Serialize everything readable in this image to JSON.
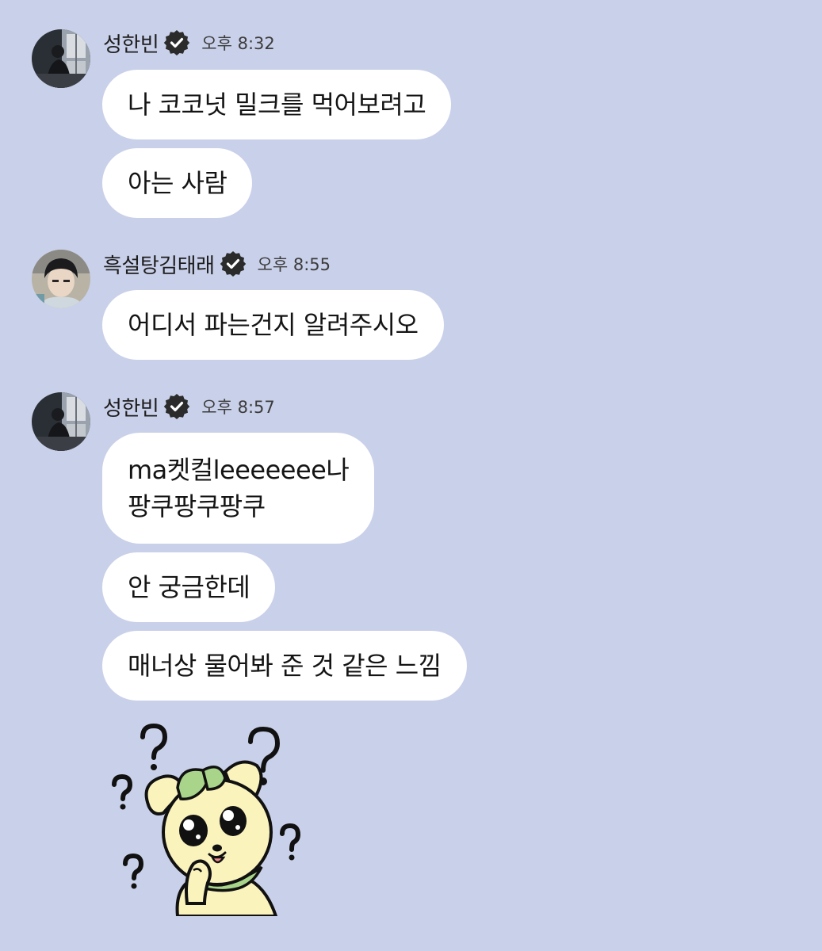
{
  "colors": {
    "background": "#c9d0e9",
    "bubble": "#ffffff",
    "verified_badge": "#2b2b2b",
    "sticker_face": "#fbf3bc",
    "sticker_leaf": "#a8d58a"
  },
  "messages": [
    {
      "sender": "성한빈",
      "verified": true,
      "time": "오후 8:32",
      "avatar": "avatar-photo-window",
      "bubbles": [
        "나 코코넛 밀크를 먹어보려고",
        "아는 사람"
      ]
    },
    {
      "sender": "흑설탕김태래",
      "verified": true,
      "time": "오후 8:55",
      "avatar": "avatar-photo-selfie",
      "bubbles": [
        "어디서 파는건지 알려주시오"
      ]
    },
    {
      "sender": "성한빈",
      "verified": true,
      "time": "오후 8:57",
      "avatar": "avatar-photo-window",
      "bubbles": [
        [
          "ma켓컬leeeeeee나",
          "팡쿠팡쿠팡쿠"
        ],
        "안 궁금한데",
        "매너상 물어봐 준 것 같은 느낌"
      ],
      "sticker": "confused-puppy-sticker-icon"
    }
  ]
}
